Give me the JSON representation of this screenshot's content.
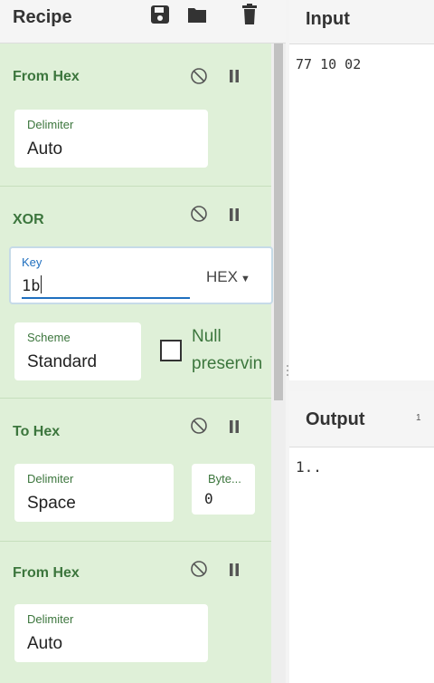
{
  "recipe": {
    "title": "Recipe",
    "icons": [
      "save-icon",
      "folder-icon",
      "trash-icon"
    ]
  },
  "operations": [
    {
      "title": "From Hex",
      "fields": [
        {
          "label": "Delimiter",
          "value": "Auto"
        }
      ]
    },
    {
      "title": "XOR",
      "key": {
        "label": "Key",
        "value": "1b",
        "format": "HEX"
      },
      "scheme": {
        "label": "Scheme",
        "value": "Standard"
      },
      "null_preserving": {
        "label": "Null preservin",
        "checked": false
      }
    },
    {
      "title": "To Hex",
      "fields": [
        {
          "label": "Delimiter",
          "value": "Space"
        },
        {
          "label": "Byte...",
          "value": "0"
        }
      ]
    },
    {
      "title": "From Hex",
      "fields": [
        {
          "label": "Delimiter",
          "value": "Auto"
        }
      ]
    }
  ],
  "input": {
    "title": "Input",
    "text": "77 10 02"
  },
  "output": {
    "title": "Output",
    "count": "1",
    "text": "1.."
  },
  "colors": {
    "recipe_bg": "#dff0d8",
    "op_title": "#3c763d",
    "active_field": "#1f6fbf"
  }
}
